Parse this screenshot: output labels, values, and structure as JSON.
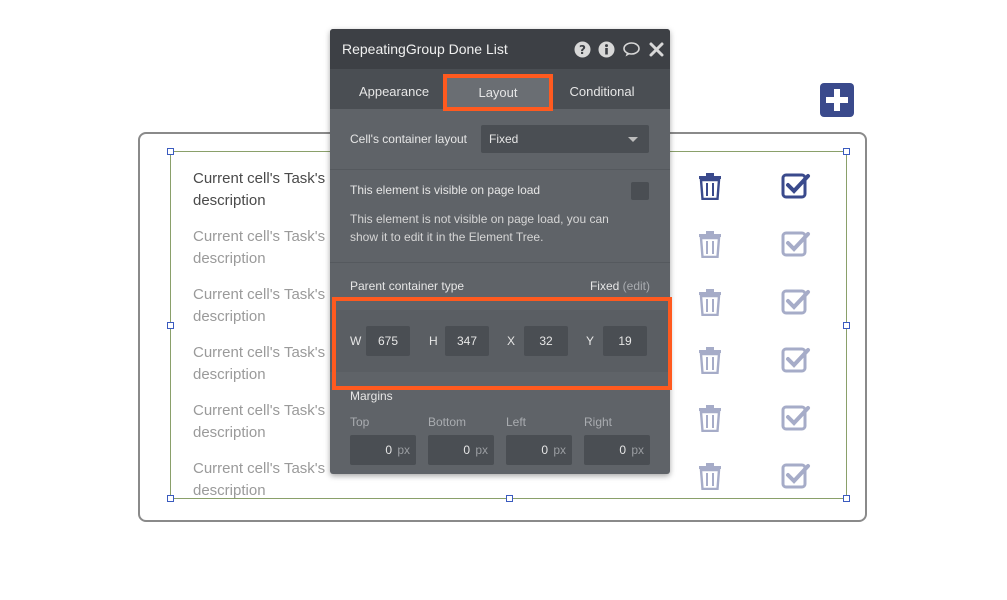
{
  "panel": {
    "title": "RepeatingGroup Done List",
    "header_icons": [
      "help-icon",
      "info-icon",
      "comment-icon",
      "close-icon"
    ],
    "tabs": [
      {
        "label": "Appearance",
        "active": false
      },
      {
        "label": "Layout",
        "active": true
      },
      {
        "label": "Conditional",
        "active": false
      }
    ],
    "cell_layout": {
      "label": "Cell's container layout",
      "value": "Fixed"
    },
    "visibility": {
      "label": "This element is visible on page load",
      "checked": false,
      "note": "This element is not visible on page load, you can show it to edit it in the Element Tree."
    },
    "parent_container": {
      "label": "Parent container type",
      "value": "Fixed",
      "edit_label": "(edit)"
    },
    "dimensions": [
      {
        "letter": "W",
        "value": "675"
      },
      {
        "letter": "H",
        "value": "347"
      },
      {
        "letter": "X",
        "value": "32"
      },
      {
        "letter": "Y",
        "value": "19"
      }
    ],
    "margins": {
      "title": "Margins",
      "fields": [
        {
          "label": "Top",
          "value": "0",
          "unit": "px"
        },
        {
          "label": "Bottom",
          "value": "0",
          "unit": "px"
        },
        {
          "label": "Left",
          "value": "0",
          "unit": "px"
        },
        {
          "label": "Right",
          "value": "0",
          "unit": "px"
        }
      ]
    }
  },
  "repeating_group": {
    "rows": [
      {
        "text": "Current cell's Task's description"
      },
      {
        "text": "Current cell's Task's description"
      },
      {
        "text": "Current cell's Task's description"
      },
      {
        "text": "Current cell's Task's description"
      },
      {
        "text": "Current cell's Task's description"
      },
      {
        "text": "Current cell's Task's description"
      }
    ]
  },
  "colors": {
    "accent_highlight": "#ff5a1f",
    "icon_active": "#3a4a8c",
    "icon_faded": "#a6acc8",
    "panel_bg": "#5f6368"
  }
}
